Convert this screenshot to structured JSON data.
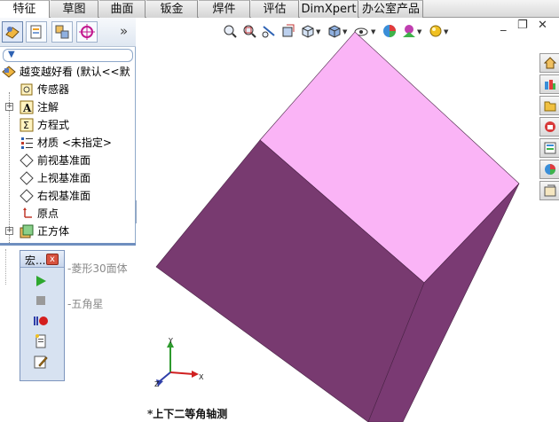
{
  "command_manager": {
    "tabs": [
      {
        "label": "特征",
        "active": true
      },
      {
        "label": "草图",
        "active": false
      },
      {
        "label": "曲面",
        "active": false
      },
      {
        "label": "钣金",
        "active": false
      },
      {
        "label": "焊件",
        "active": false
      },
      {
        "label": "评估",
        "active": false
      },
      {
        "label": "DimXpert",
        "active": false
      },
      {
        "label": "办公室产品",
        "active": false
      }
    ]
  },
  "feature_tree": {
    "root_label": "越变越好看 (默认<<默",
    "items": [
      {
        "label": "传感器",
        "icon": "sensor-icon"
      },
      {
        "label": "注解",
        "icon": "annotation-icon",
        "expandable": true
      },
      {
        "label": "方程式",
        "icon": "equation-icon"
      },
      {
        "label": "材质 <未指定>",
        "icon": "material-icon"
      },
      {
        "label": "前视基准面",
        "icon": "plane-icon"
      },
      {
        "label": "上视基准面",
        "icon": "plane-icon"
      },
      {
        "label": "右视基准面",
        "icon": "plane-icon"
      },
      {
        "label": "原点",
        "icon": "origin-icon"
      },
      {
        "label": "正方体",
        "icon": "extrude-icon",
        "expandable": true
      }
    ],
    "lower_items": [
      {
        "label": "-菱形30面体"
      },
      {
        "label": "-五角星"
      }
    ]
  },
  "macro_toolbar": {
    "title": "宏...",
    "close": "x",
    "buttons": [
      "run-macro",
      "stop-macro",
      "record-pause-macro",
      "new-macro",
      "edit-macro"
    ]
  },
  "graphics": {
    "view_name": "*上下二等角轴测",
    "triad": {
      "x": "X",
      "y": "Y",
      "z": "Z"
    },
    "colors": {
      "top_face": "#FAB4F6",
      "left_face": "#783A70",
      "right_face": "#7A3A73"
    }
  },
  "panel": {
    "more": "»"
  }
}
